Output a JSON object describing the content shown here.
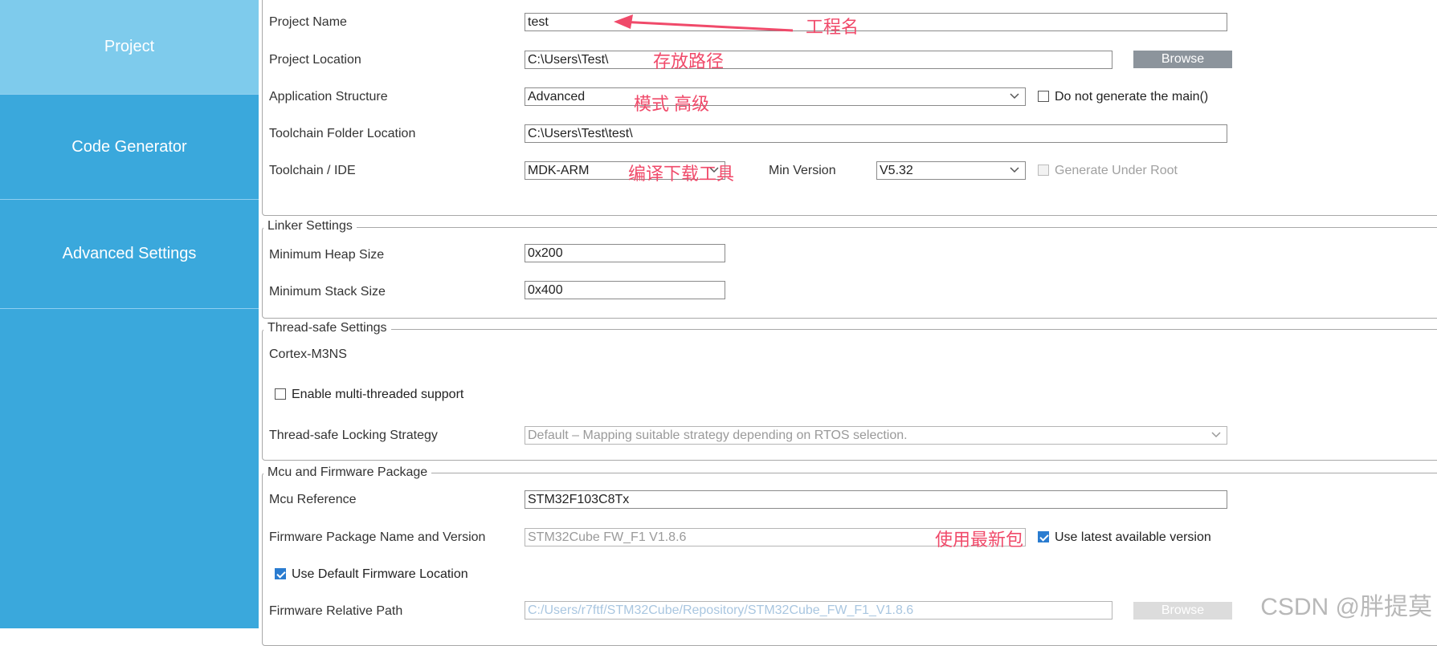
{
  "sidebar": {
    "items": [
      {
        "label": "Project",
        "active": true
      },
      {
        "label": "Code Generator",
        "active": false
      },
      {
        "label": "Advanced Settings",
        "active": false
      }
    ]
  },
  "project_settings": {
    "name_label": "Project Name",
    "name_value": "test",
    "location_label": "Project Location",
    "location_value": "C:\\Users\\Test\\",
    "browse_label": "Browse",
    "structure_label": "Application Structure",
    "structure_value": "Advanced",
    "no_main_label": "Do not generate the main()",
    "no_main_checked": false,
    "toolchain_folder_label": "Toolchain Folder Location",
    "toolchain_folder_value": "C:\\Users\\Test\\test\\",
    "ide_label": "Toolchain / IDE",
    "ide_value": "MDK-ARM",
    "min_version_label": "Min Version",
    "min_version_value": "V5.32",
    "gen_under_root_label": "Generate Under Root",
    "gen_under_root_checked": false
  },
  "linker_settings": {
    "legend": "Linker Settings",
    "heap_label": "Minimum Heap Size",
    "heap_value": "0x200",
    "stack_label": "Minimum Stack Size",
    "stack_value": "0x400"
  },
  "thread_safe": {
    "legend": "Thread-safe Settings",
    "core_label": "Cortex-M3NS",
    "multithread_label": "Enable multi-threaded support",
    "multithread_checked": false,
    "strategy_label": "Thread-safe Locking Strategy",
    "strategy_value": "Default  –  Mapping suitable strategy depending on RTOS selection."
  },
  "mcu_package": {
    "legend": "Mcu and Firmware Package",
    "mcu_ref_label": "Mcu Reference",
    "mcu_ref_value": "STM32F103C8Tx",
    "fw_label": "Firmware Package Name and Version",
    "fw_value": "STM32Cube FW_F1 V1.8.6",
    "use_latest_label": "Use latest available version",
    "use_latest_checked": true,
    "use_default_loc_label": "Use Default Firmware Location",
    "use_default_loc_checked": true,
    "fw_path_label": "Firmware Relative Path",
    "fw_path_value": "C:/Users/r7ftf/STM32Cube/Repository/STM32Cube_FW_F1_V1.8.6",
    "browse_label": "Browse"
  },
  "annotations": {
    "project_name": "工程名",
    "location": "存放路径",
    "structure": "模式 高级",
    "ide": "编译下载工具",
    "latest": "使用最新包"
  },
  "colors": {
    "sidebar": "#3aa8dc",
    "sidebar_active": "#7ecbec",
    "annotation": "#f04a6a",
    "button": "#8c949c",
    "checkbox_checked": "#2a7cd0"
  },
  "watermark": "CSDN @胖提莫"
}
